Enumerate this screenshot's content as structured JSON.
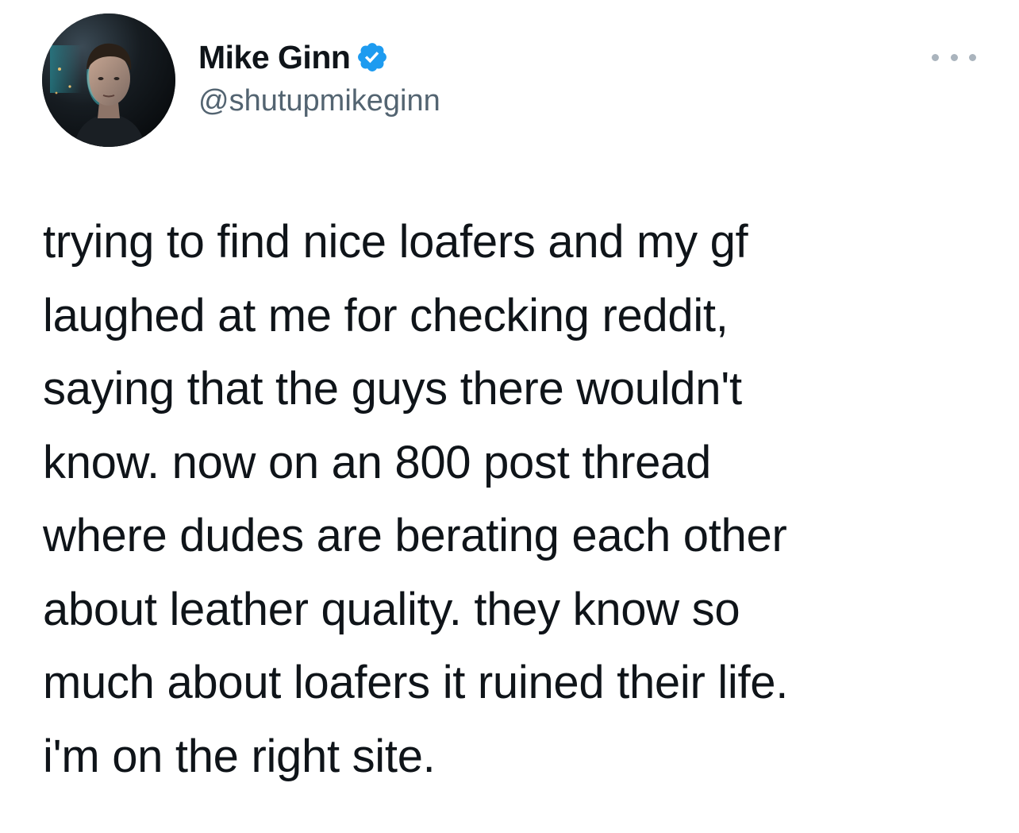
{
  "tweet": {
    "author": {
      "display_name": "Mike Ginn",
      "handle": "@shutupmikeginn",
      "verified": true,
      "verified_icon": "verified-badge-icon",
      "avatar_icon": "profile-photo"
    },
    "more_icon": "more-options-icon",
    "text_lines": [
      "trying to find nice loafers and my gf",
      "laughed at me for checking reddit,",
      "saying that the guys there wouldn't",
      "know. now on an 800 post thread",
      "where dudes are berating each other",
      "about leather quality. they know so",
      "much about loafers it ruined their life.",
      "i'm on the right site."
    ]
  },
  "colors": {
    "text": "#0f1419",
    "secondary_text": "#536471",
    "verified_blue": "#1d9bf0",
    "background": "#ffffff"
  }
}
